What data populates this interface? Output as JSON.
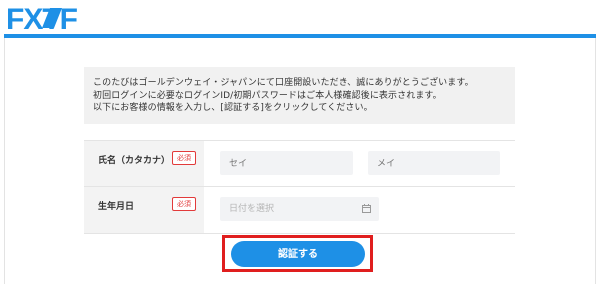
{
  "header": {
    "logo_text": "FXTF",
    "accent_color": "#1e90e6"
  },
  "info": {
    "lines": [
      "このたびはゴールデンウェイ・ジャパンにて口座開設いただき、誠にありがとうございます。",
      "初回ログインに必要なログインID/初期パスワードはご本人様確認後に表示されます。",
      "以下にお客様の情報を入力し、[認証する]をクリックしてください。"
    ]
  },
  "form": {
    "name_kana": {
      "label": "氏名（カタカナ）",
      "required_badge": "必須",
      "sei_placeholder": "セイ",
      "mei_placeholder": "メイ"
    },
    "birthdate": {
      "label": "生年月日",
      "required_badge": "必須",
      "placeholder": "日付を選択",
      "icon": "calendar-icon"
    }
  },
  "submit": {
    "label": "認証する",
    "highlight_color": "#e01e1e"
  }
}
